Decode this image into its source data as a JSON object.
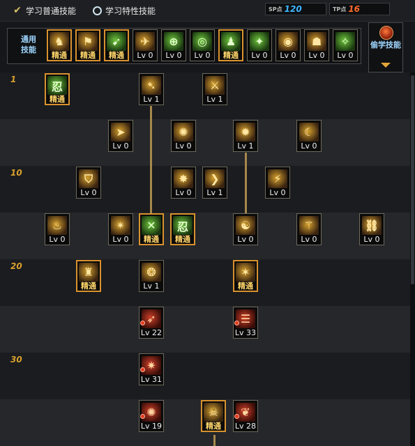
{
  "tabs": {
    "normal": "学习普通技能",
    "special": "学习特性技能"
  },
  "points": {
    "sp_label": "SP点",
    "sp_value": "120",
    "tp_label": "TP点",
    "tp_value": "16"
  },
  "common": {
    "label": "通用技能",
    "skills": [
      "精通",
      "精通",
      "精通",
      "Lv 0",
      "Lv 0",
      "Lv 0",
      "精通",
      "Lv 0",
      "Lv 0",
      "Lv 0",
      "Lv 0",
      "Lv 0"
    ]
  },
  "steal": {
    "label": "偷学技能"
  },
  "levels": [
    "1",
    "10",
    "20",
    "30"
  ],
  "tree": {
    "r0": [
      "精通",
      "Lv 1",
      "Lv 1"
    ],
    "r1": [
      "Lv 0",
      "Lv 0",
      "Lv 1",
      "Lv 0"
    ],
    "r2": [
      "Lv 0",
      "Lv 0",
      "Lv 1",
      "Lv 0"
    ],
    "r3": [
      "Lv 0",
      "Lv 0",
      "精通",
      "精通",
      "Lv 0",
      "Lv 0",
      "Lv 0"
    ],
    "r4": [
      "精通",
      "Lv 1",
      "精通"
    ],
    "r5": [
      "Lv 22",
      "Lv 33"
    ],
    "r6": [
      "Lv 31"
    ],
    "r7": [
      "Lv 19",
      "精通",
      "Lv 28"
    ]
  },
  "colors": {
    "mastery_border": "#d9922e",
    "mastery_text": "#ffd56a",
    "level_marker": "#d9a02e",
    "link_line": "#a7884c",
    "sp_value": "#3fb6ff",
    "tp_value": "#ff6a2a"
  }
}
